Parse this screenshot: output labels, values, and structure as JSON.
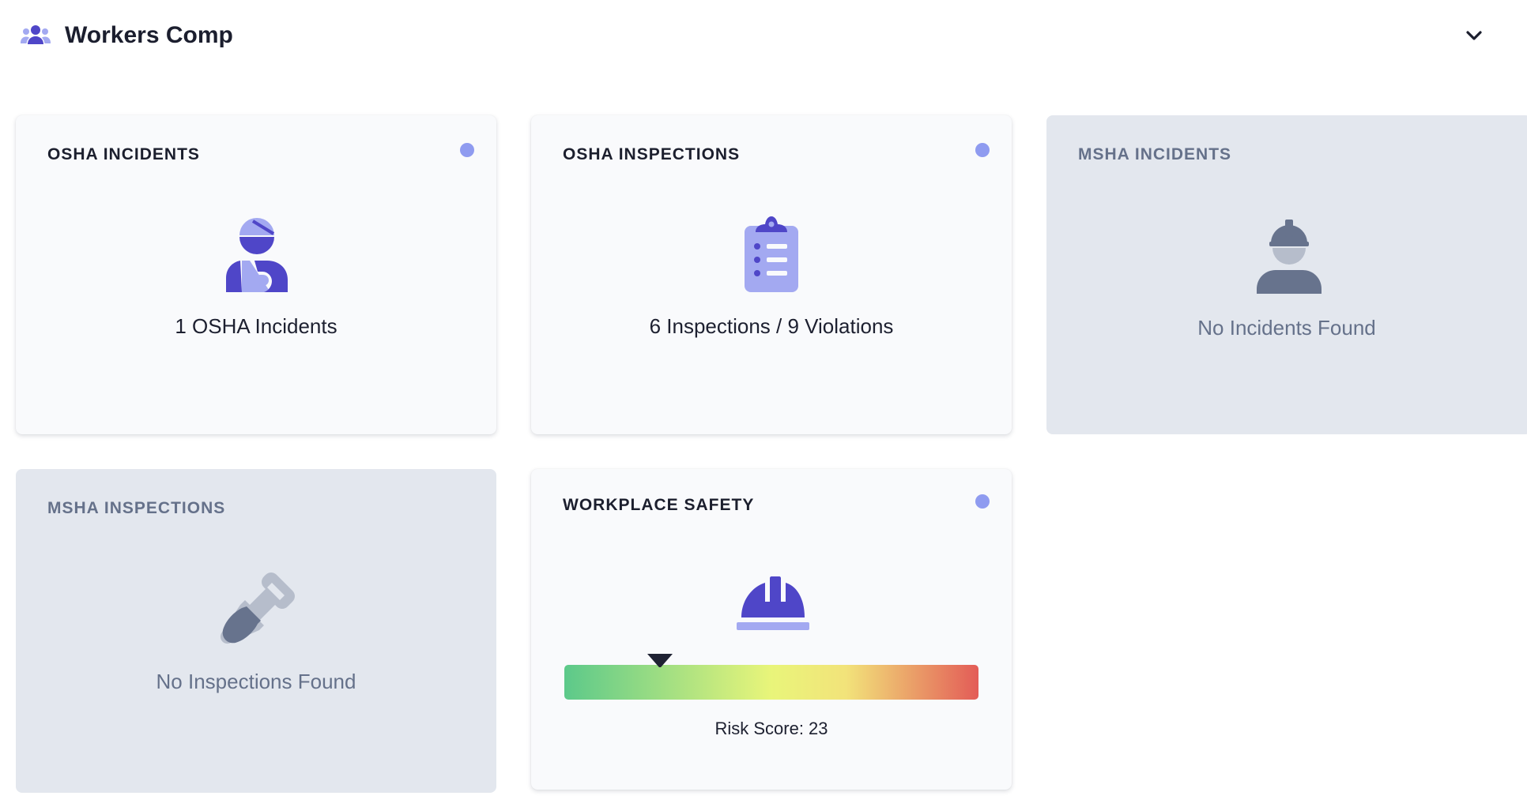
{
  "header": {
    "title": "Workers Comp",
    "icon": "users-icon",
    "toggle_icon": "chevron-down-icon"
  },
  "colors": {
    "accent": "#4f46c8",
    "accent_light": "#a3a9f1",
    "status_dot": "#8f9bf0",
    "inactive_icon": "#67738d",
    "inactive_bg": "#e3e7ee",
    "card_bg": "#f9fafc"
  },
  "cards": {
    "osha_incidents": {
      "title": "OSHA INCIDENTS",
      "icon": "injured-worker-icon",
      "text": "1 OSHA Incidents",
      "active": true
    },
    "osha_inspections": {
      "title": "OSHA INSPECTIONS",
      "icon": "clipboard-list-icon",
      "text": "6 Inspections / 9 Violations",
      "active": true
    },
    "msha_incidents": {
      "title": "MSHA INCIDENTS",
      "icon": "hard-hat-worker-icon",
      "text": "No Incidents Found",
      "active": false
    },
    "msha_inspections": {
      "title": "MSHA INSPECTIONS",
      "icon": "shovel-icon",
      "text": "No Inspections Found",
      "active": false
    },
    "workplace_safety": {
      "title": "WORKPLACE SAFETY",
      "icon": "hard-hat-icon",
      "risk_label": "Risk Score: 23",
      "risk_score": 23,
      "gauge_colors": [
        "#5cc98a",
        "#e9f57a",
        "#e35c57"
      ],
      "active": true
    }
  }
}
